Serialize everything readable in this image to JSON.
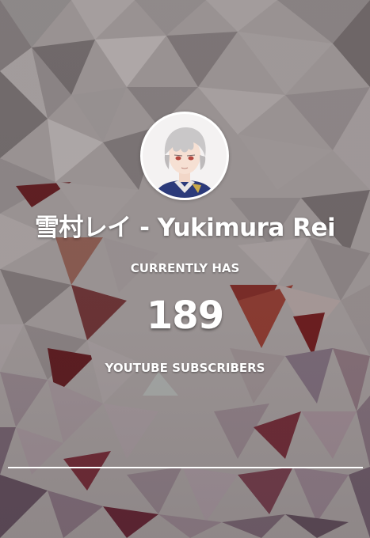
{
  "channel": {
    "name": "雪村レイ - Yukimura Rei",
    "avatar": "channel-avatar"
  },
  "stats": {
    "label_top": "CURRENTLY HAS",
    "count": "189",
    "label_bottom": "YOUTUBE SUBSCRIBERS"
  },
  "progress": {
    "fraction": 1.0
  },
  "colors": {
    "text": "#ffffff",
    "accent_red": "#6e1e1e"
  }
}
